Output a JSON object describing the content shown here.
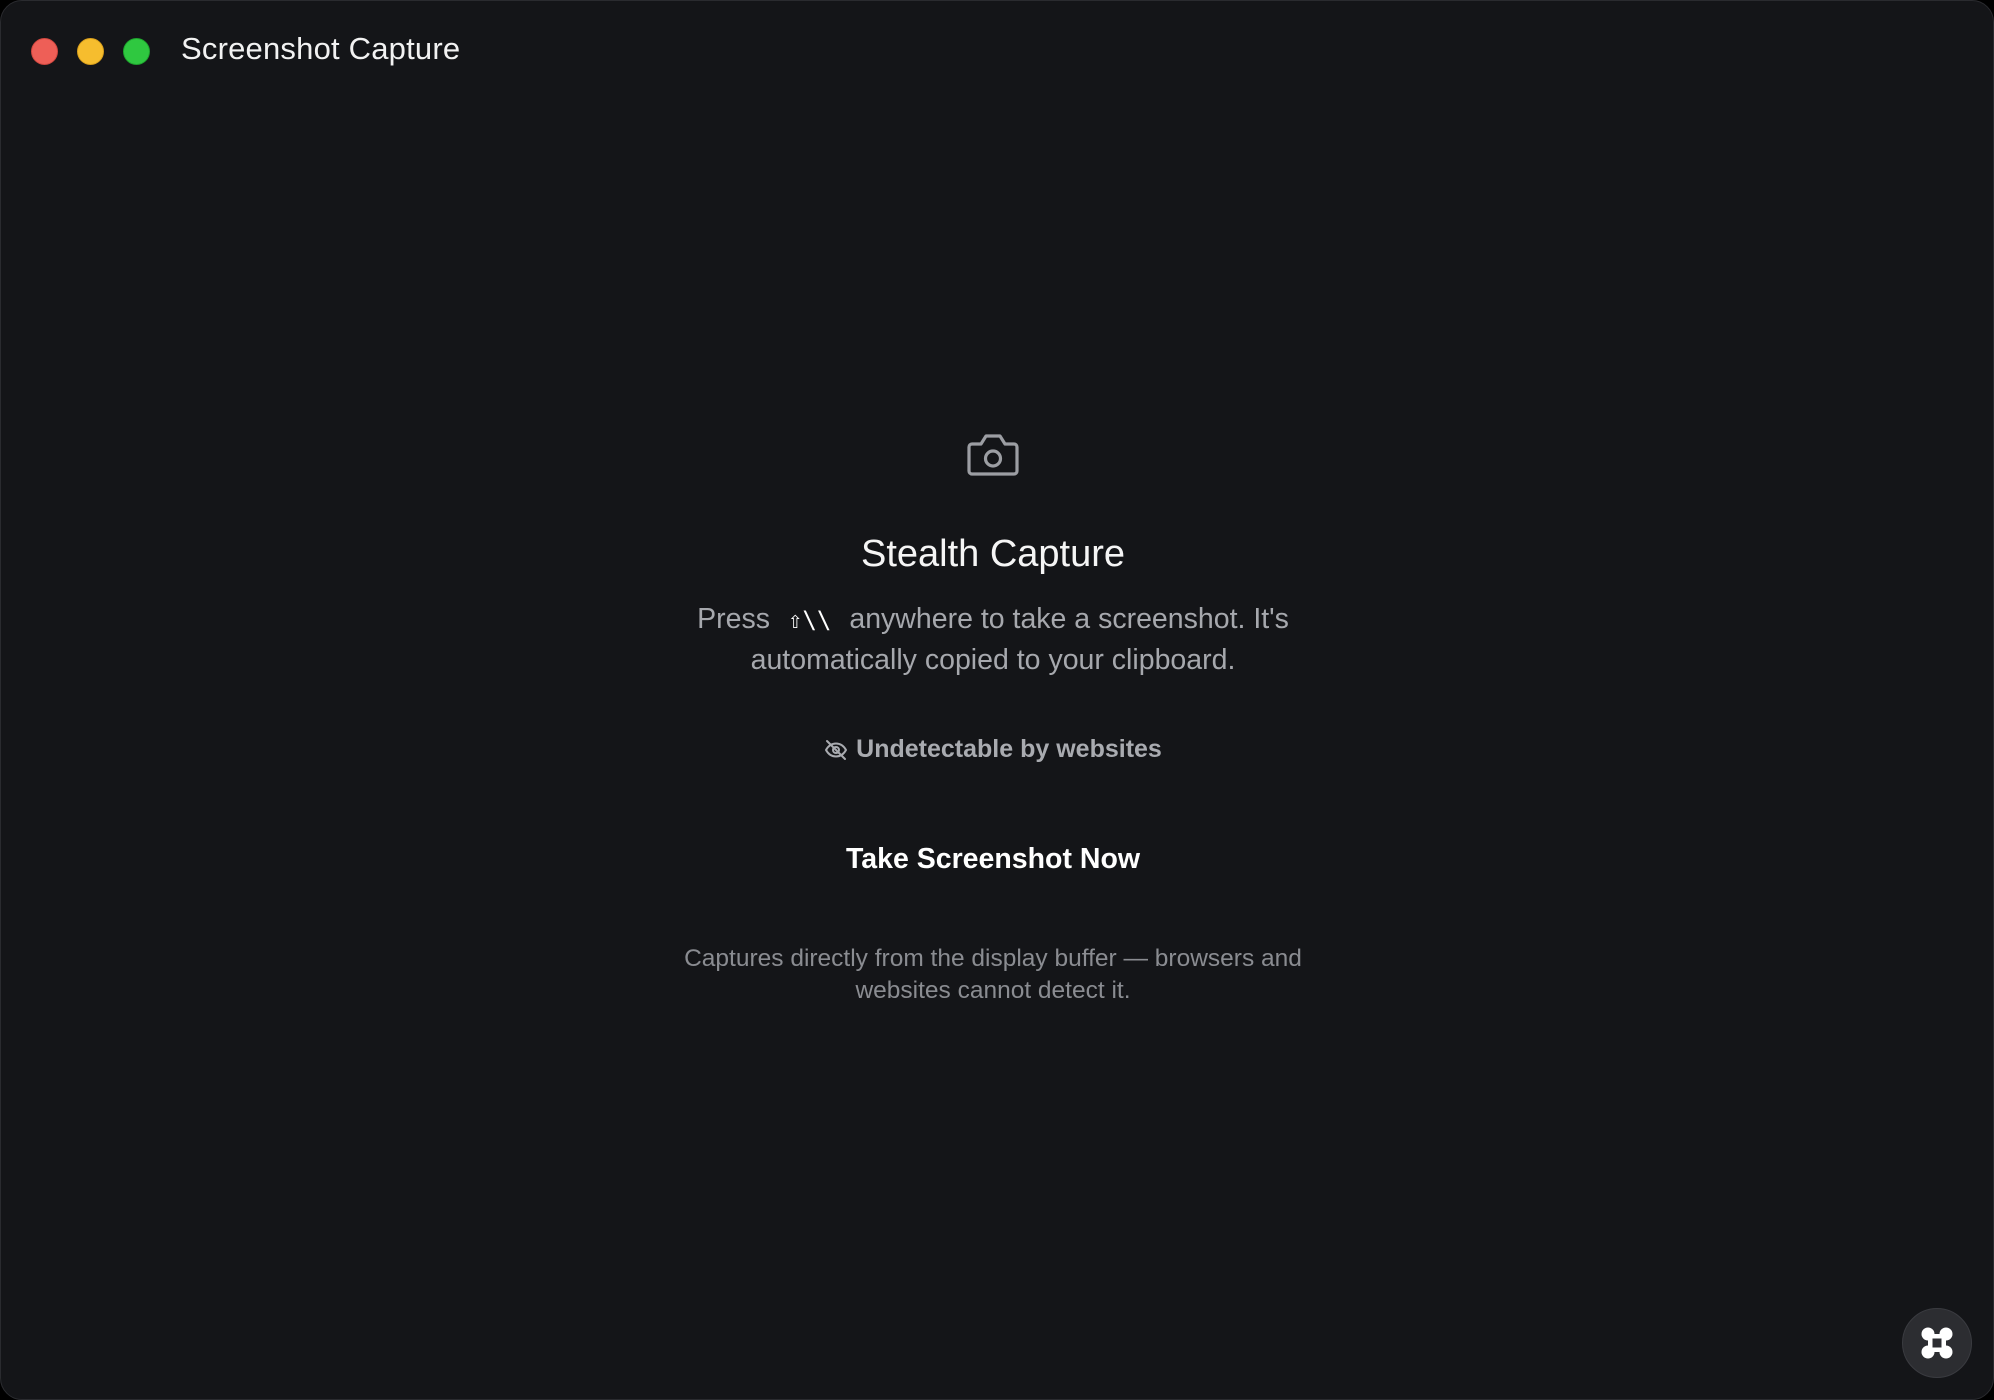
{
  "window": {
    "title": "Screenshot Capture",
    "traffic_lights": {
      "close_color": "#ee5f57",
      "minimize_color": "#f6bd2e",
      "maximize_color": "#2fc840"
    }
  },
  "main": {
    "icon": "camera-icon",
    "heading": "Stealth Capture",
    "description_prefix": "Press",
    "shortcut": "⇧\\\\",
    "description_suffix": "anywhere to take a screenshot. It's automatically copied to your clipboard.",
    "badge_icon": "eye-off-icon",
    "badge_text": "Undetectable by websites",
    "button_label": "Take Screenshot Now",
    "footnote": "Captures directly from the display buffer — browsers and websites cannot detect it."
  },
  "floating_button": {
    "icon": "command-icon"
  },
  "colors": {
    "background": "#141518",
    "text_primary": "#f5f5f5",
    "text_secondary": "#a6a8ad",
    "text_muted": "#8a8c91"
  }
}
